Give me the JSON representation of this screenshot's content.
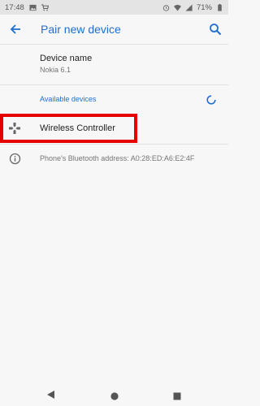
{
  "status_bar": {
    "time": "17:48",
    "battery": "71%",
    "icons": [
      "image-icon",
      "shopping-cart-icon",
      "alarm-icon",
      "wifi-icon",
      "cellular-icon",
      "battery-icon"
    ]
  },
  "app_bar": {
    "title": "Pair new device",
    "back_icon": "arrow-back-icon",
    "search_icon": "search-icon"
  },
  "device_name": {
    "title": "Device name",
    "value": "Nokia 6.1"
  },
  "available_devices": {
    "header": "Available devices",
    "spinner_icon": "loading-spinner-icon",
    "items": [
      {
        "label": "Wireless Controller",
        "icon": "gamepad-icon"
      }
    ]
  },
  "footer_info": {
    "text": "Phone's Bluetooth address: A0:28:ED:A6:E2:4F",
    "icon": "info-icon"
  },
  "colors": {
    "accent": "#1e6fd1",
    "highlight": "#e60000",
    "background": "#f7f7f7"
  },
  "nav_bar": {
    "icons": [
      "nav-back-icon",
      "nav-home-icon",
      "nav-recents-icon"
    ]
  }
}
